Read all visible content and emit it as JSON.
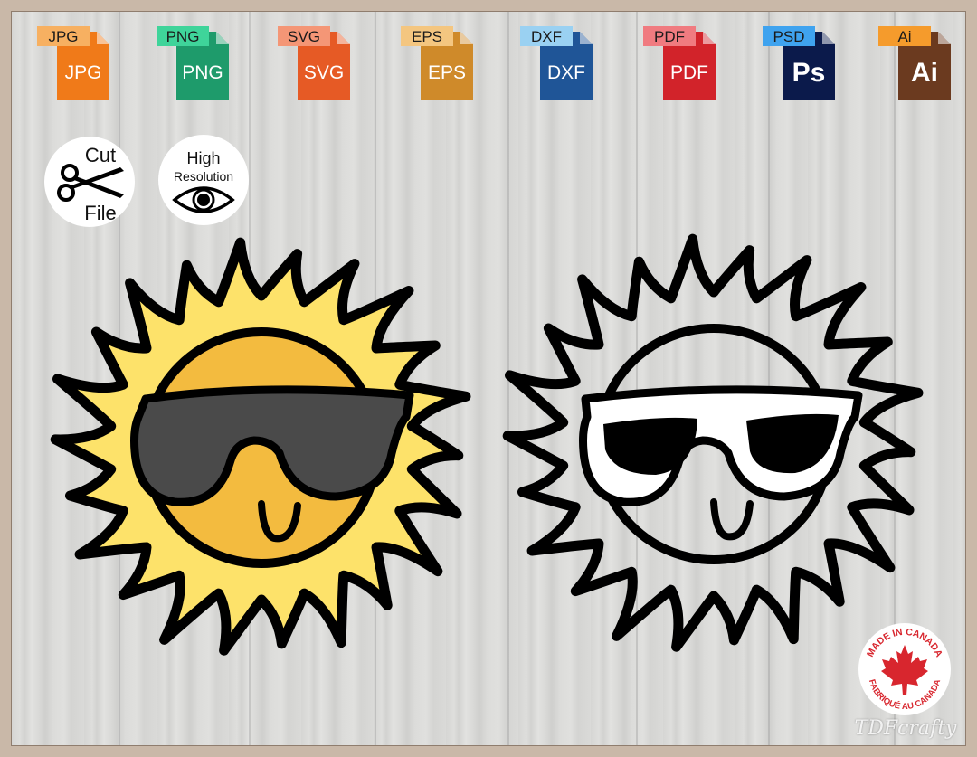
{
  "formats": [
    {
      "tab": "JPG",
      "label": "JPG",
      "color": "#f07a19",
      "tab_color": "#f7b061",
      "big": false
    },
    {
      "tab": "PNG",
      "label": "PNG",
      "color": "#1e9b6b",
      "tab_color": "#3fd49a",
      "big": false
    },
    {
      "tab": "SVG",
      "label": "SVG",
      "color": "#e65a25",
      "tab_color": "#f49676",
      "big": false
    },
    {
      "tab": "EPS",
      "label": "EPS",
      "color": "#cf8a2a",
      "tab_color": "#f4c680",
      "big": false
    },
    {
      "tab": "DXF",
      "label": "DXF",
      "color": "#1f5597",
      "tab_color": "#9ad1f2",
      "big": false
    },
    {
      "tab": "PDF",
      "label": "PDF",
      "color": "#d2232a",
      "tab_color": "#f07b80",
      "big": false
    },
    {
      "tab": "PSD",
      "label": "Ps",
      "color": "#0b1a4b",
      "tab_color": "#3fa3ef",
      "big": true
    },
    {
      "tab": "Ai",
      "label": "Ai",
      "color": "#6b3a1f",
      "tab_color": "#f59b2c",
      "big": true
    }
  ],
  "badges": {
    "cut_top": "Cut",
    "cut_bottom": "File",
    "high_top": "High",
    "high_bottom": "Resolution"
  },
  "colors": {
    "sun_rays": "#fde26a",
    "sun_face": "#f3bb3f",
    "glasses": "#4a4a4a",
    "outline": "#000000",
    "maple": "#d8262e"
  },
  "made_in_canada": {
    "top": "MADE IN CANADA",
    "bottom": "FABRIQUÉ AU CANADA"
  },
  "watermark": "TDFcrafty",
  "icons": {
    "cut": "scissors-icon",
    "high_res": "eye-icon",
    "canada": "maple-leaf-icon"
  }
}
